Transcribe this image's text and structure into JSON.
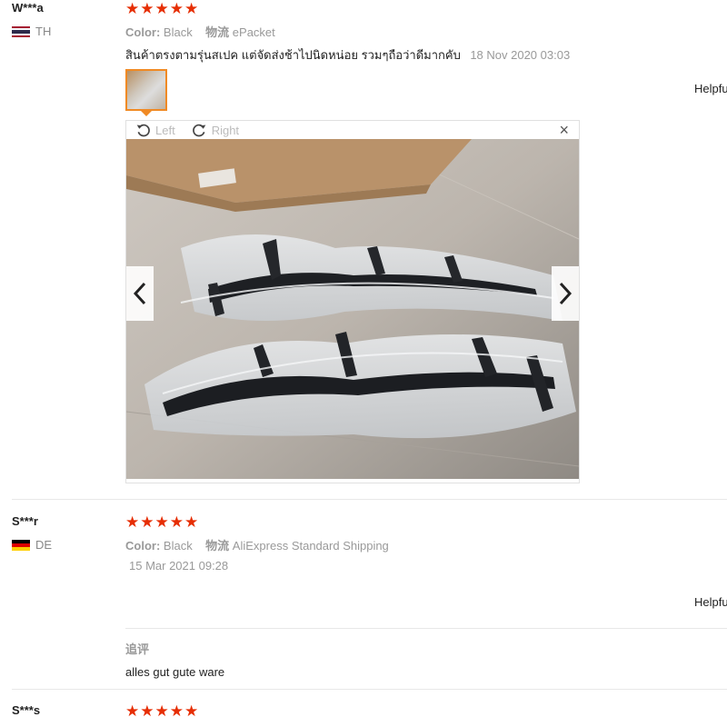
{
  "reviews": [
    {
      "user": "W***a",
      "country": "TH",
      "stars": "★★★★★",
      "color_label": "Color:",
      "color_value": "Black",
      "logistics_label": "物流",
      "logistics_value": "ePacket",
      "text": "สินค้าตรงตามรุ่นสเปค แต่จัดส่งช้าไปนิดหน่อย รวมๆถือว่าดีมากคับ",
      "date": "18 Nov 2020 03:03",
      "helpful": "Helpfu"
    },
    {
      "user": "S***r",
      "country": "DE",
      "stars": "★★★★★",
      "color_label": "Color:",
      "color_value": "Black",
      "logistics_label": "物流",
      "logistics_value": "AliExpress Standard Shipping",
      "date": "15 Mar 2021 09:28",
      "helpful": "Helpfu",
      "additional_label": "追评",
      "additional_text": "alles gut gute ware"
    },
    {
      "user": "S***s",
      "stars": "★★★★★"
    }
  ],
  "viewer": {
    "rotate_left": "Left",
    "rotate_right": "Right",
    "close": "×"
  },
  "icons": {
    "rotate_left": "rotate-left-icon",
    "rotate_right": "rotate-right-icon",
    "prev": "chevron-left-icon",
    "next": "chevron-right-icon"
  },
  "colors": {
    "star": "#e62e04",
    "thumb_border": "#f08a24"
  }
}
